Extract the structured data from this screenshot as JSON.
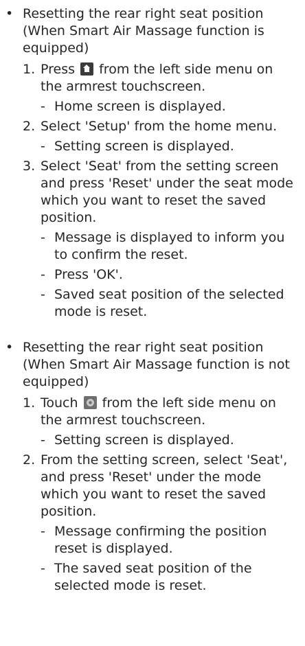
{
  "sections": [
    {
      "title": "Resetting the rear right seat position (When Smart Air Massage function is equipped)",
      "steps": [
        {
          "num": "1.",
          "pre": "Press",
          "icon": "home-icon",
          "post": "from the left side menu on the armrest touchscreen.",
          "subs": [
            "Home screen is displayed."
          ]
        },
        {
          "num": "2.",
          "text": "Select 'Setup' from the home menu.",
          "subs": [
            "Setting screen is displayed."
          ]
        },
        {
          "num": "3.",
          "text": "Select 'Seat' from the setting screen and press 'Reset' under the seat mode which you want to reset the saved position.",
          "subs": [
            "Message is displayed to inform you to confirm the reset.",
            "Press 'OK'.",
            "Saved seat position of the selected mode is reset."
          ]
        }
      ]
    },
    {
      "title": "Resetting the rear right seat position (When Smart Air Massage function is not equipped)",
      "steps": [
        {
          "num": "1.",
          "pre": "Touch",
          "icon": "gear-icon",
          "post": "from the left side menu on the armrest touchscreen.",
          "subs": [
            "Setting screen is displayed."
          ]
        },
        {
          "num": "2.",
          "text": "From the setting screen, select 'Seat', and press 'Reset' under the mode which you want to reset the saved position.",
          "subs": [
            "Message confirming the position reset is displayed.",
            "The saved seat position of the selected mode is reset."
          ]
        }
      ]
    }
  ],
  "bullet_char": "•",
  "dash_char": "-"
}
